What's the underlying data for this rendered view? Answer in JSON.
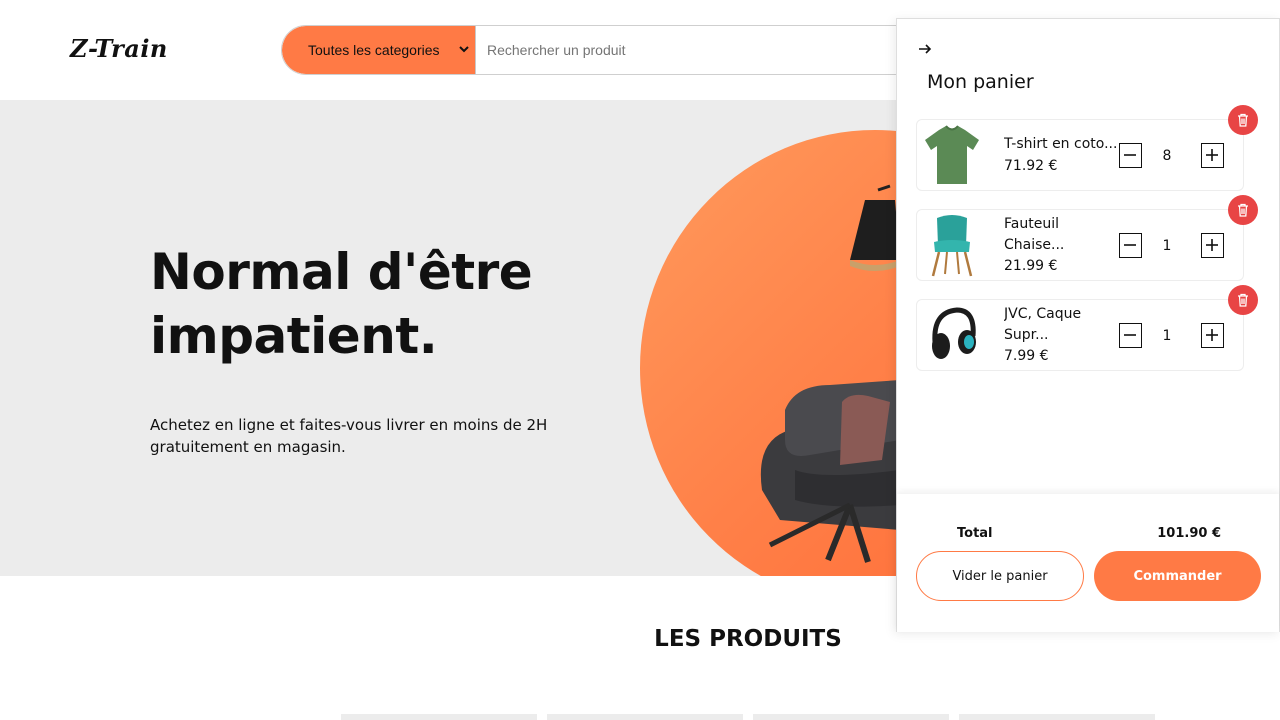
{
  "header": {
    "logo": "Z-Train",
    "category_select": "Toutes les categories",
    "search_placeholder": "Rechercher un produit"
  },
  "hero": {
    "title": "Normal d'être impatient.",
    "subtitle": "Achetez en ligne et faites-vous livrer en moins de 2H gratuitement en magasin."
  },
  "products": {
    "title": "LES PRODUITS"
  },
  "cart": {
    "title": "Mon panier",
    "items": [
      {
        "name": "T-shirt en coto...",
        "price": "71.92 €",
        "quantity": "8",
        "image": "green-tshirt"
      },
      {
        "name": "Fauteuil Chaise...",
        "price": "21.99 €",
        "quantity": "1",
        "image": "teal-chair"
      },
      {
        "name": "JVC, Caque Supr...",
        "price": "7.99 €",
        "quantity": "1",
        "image": "headphones"
      }
    ],
    "total_label": "Total",
    "total_value": "101.90 €",
    "empty_button": "Vider le panier",
    "order_button": "Commander"
  },
  "colors": {
    "accent": "#ff7a45",
    "delete": "#e84545",
    "hero_bg": "#ececec"
  },
  "icons": [
    "arrow-right-icon",
    "trash-icon",
    "minus-icon",
    "plus-icon",
    "chevron-down-icon"
  ]
}
